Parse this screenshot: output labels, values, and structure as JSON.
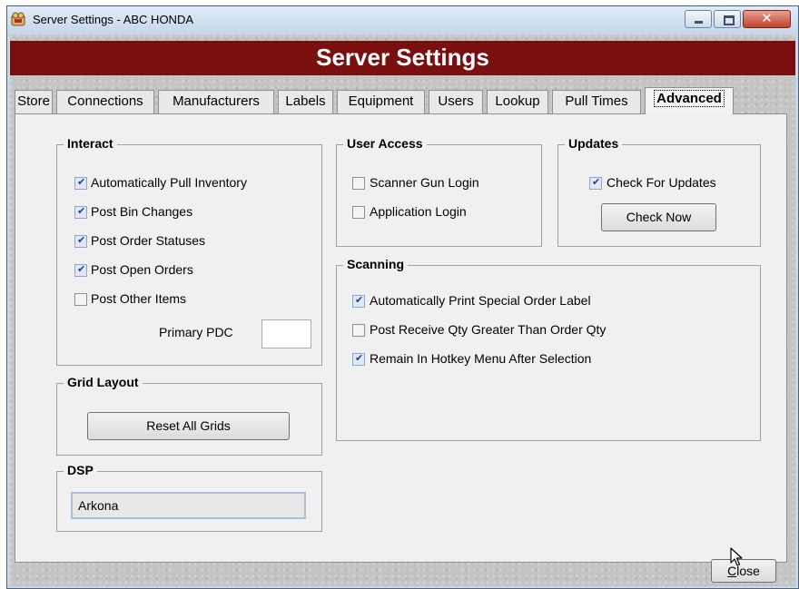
{
  "window": {
    "title": "Server Settings - ABC HONDA",
    "close_glyph": "✕",
    "icons": {
      "app": "app-icon",
      "minimize": "minimize-icon",
      "maximize": "maximize-icon",
      "close": "close-icon"
    }
  },
  "banner": {
    "title": "Server Settings",
    "color": "#7a0f0f"
  },
  "tabs": [
    {
      "label": "Store"
    },
    {
      "label": "Connections"
    },
    {
      "label": "Manufacturers"
    },
    {
      "label": "Labels"
    },
    {
      "label": "Equipment"
    },
    {
      "label": "Users"
    },
    {
      "label": "Lookup"
    },
    {
      "label": "Pull Times"
    },
    {
      "label": "Advanced",
      "active": true
    }
  ],
  "interact": {
    "title": "Interact",
    "items": [
      {
        "label": "Automatically Pull Inventory",
        "checked": true
      },
      {
        "label": "Post Bin Changes",
        "checked": true
      },
      {
        "label": "Post Order Statuses",
        "checked": true
      },
      {
        "label": "Post Open Orders",
        "checked": true
      },
      {
        "label": "Post Other Items",
        "checked": false
      }
    ],
    "primary_pdc_label": "Primary PDC",
    "primary_pdc_value": ""
  },
  "grid_layout": {
    "title": "Grid Layout",
    "reset_button": "Reset All Grids"
  },
  "dsp": {
    "title": "DSP",
    "value": "Arkona"
  },
  "user_access": {
    "title": "User Access",
    "items": [
      {
        "label": "Scanner Gun Login",
        "checked": false
      },
      {
        "label": "Application Login",
        "checked": false
      }
    ]
  },
  "updates": {
    "title": "Updates",
    "check_label": "Check For Updates",
    "checked": true,
    "check_now_button": "Check Now"
  },
  "scanning": {
    "title": "Scanning",
    "items": [
      {
        "label": "Automatically Print Special Order Label",
        "checked": true
      },
      {
        "label": "Post Receive Qty Greater Than Order Qty",
        "checked": false
      },
      {
        "label": "Remain In Hotkey Menu After Selection",
        "checked": true
      }
    ]
  },
  "footer": {
    "close_button": "Close",
    "close_accel": "C",
    "close_rest": "lose"
  }
}
